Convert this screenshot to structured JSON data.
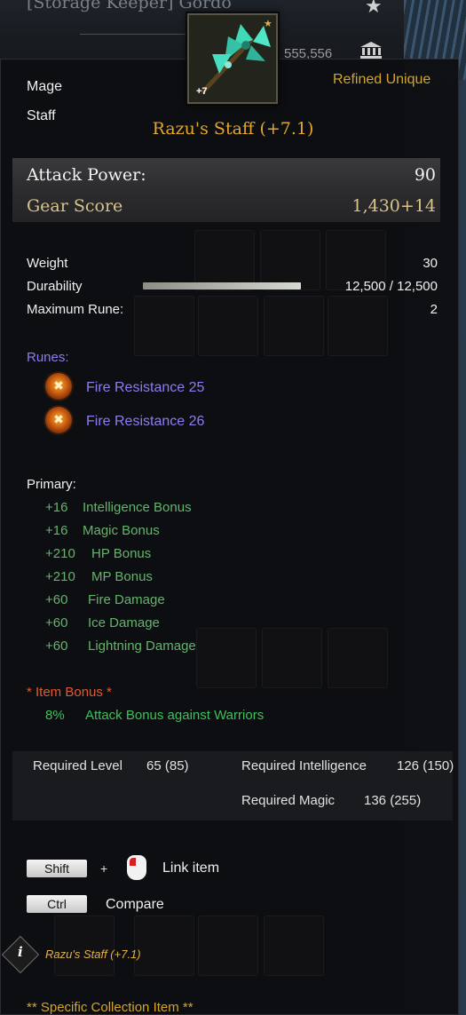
{
  "background": {
    "window_title": "[Storage Keeper] Gordo",
    "money": "555,556"
  },
  "item": {
    "class": "Mage",
    "type": "Staff",
    "grade": "Refined Unique",
    "name": "Razu's Staff (+7.1)",
    "enhancement_badge": "+7",
    "icon": "staff-icon",
    "accent_color": "#e3a72e"
  },
  "stats": {
    "attack_power_label": "Attack Power:",
    "attack_power_value": "90",
    "gear_score_label": "Gear Score",
    "gear_score_value": "1,430+14"
  },
  "info": {
    "weight_label": "Weight",
    "weight_value": "30",
    "durability_label": "Durability",
    "durability_value": "12,500 / 12,500",
    "durability_fraction": 1.0,
    "max_rune_label": "Maximum Rune:",
    "max_rune_value": "2"
  },
  "runes": {
    "label": "Runes:",
    "items": [
      {
        "name": "Fire Resistance 25",
        "icon": "fire-rune-icon"
      },
      {
        "name": "Fire Resistance 26",
        "icon": "fire-rune-icon"
      }
    ]
  },
  "primary": {
    "label": "Primary:",
    "items": [
      {
        "value": "+16",
        "name": "Intelligence Bonus"
      },
      {
        "value": "+16",
        "name": "Magic Bonus"
      },
      {
        "value": "+210",
        "name": "HP Bonus"
      },
      {
        "value": "+210",
        "name": "MP Bonus"
      },
      {
        "value": "+60",
        "name": "Fire Damage"
      },
      {
        "value": "+60",
        "name": "Ice Damage"
      },
      {
        "value": "+60",
        "name": "Lightning Damage"
      }
    ]
  },
  "item_bonus": {
    "label": "*  Item Bonus *",
    "value": "8%",
    "name": "Attack Bonus against Warriors"
  },
  "requirements": {
    "level_label": "Required Level",
    "level_value": "65 (85)",
    "intelligence_label": "Required Intelligence",
    "intelligence_value": "126 (150)",
    "magic_label": "Required Magic",
    "magic_value": "136 (255)"
  },
  "hints": {
    "shift_key": "Shift",
    "plus": "+",
    "link_label": "Link item",
    "ctrl_key": "Ctrl",
    "compare_label": "Compare"
  },
  "footer": {
    "info_icon": "i",
    "item_name": "Razu's Staff (+7.1)",
    "collection": "** Specific Collection Item **"
  }
}
